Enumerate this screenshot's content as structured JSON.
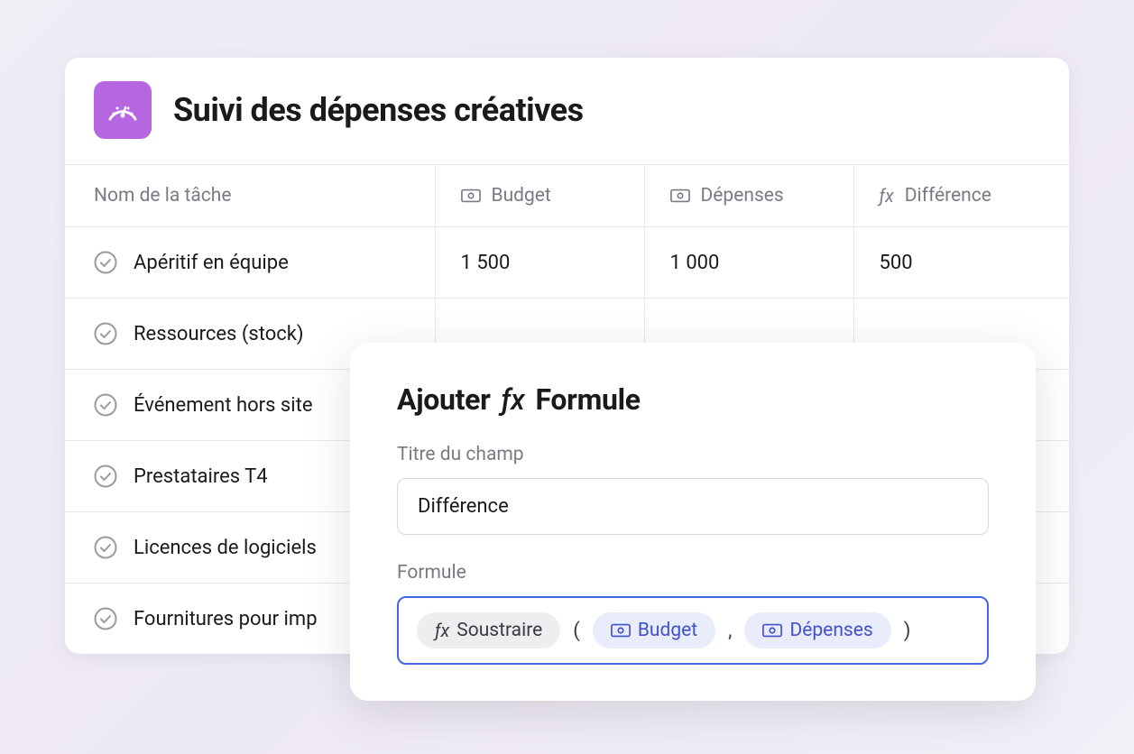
{
  "header": {
    "title": "Suivi des dépenses créatives"
  },
  "columns": {
    "task": "Nom de la tâche",
    "budget": "Budget",
    "expenses": "Dépenses",
    "difference": "Différence"
  },
  "rows": [
    {
      "task": "Apéritif en équipe",
      "budget": "1 500",
      "expenses": "1 000",
      "difference": "500"
    },
    {
      "task": "Ressources (stock)",
      "budget": "",
      "expenses": "",
      "difference": ""
    },
    {
      "task": "Événement hors site",
      "budget": "",
      "expenses": "",
      "difference": ""
    },
    {
      "task": "Prestataires T4",
      "budget": "",
      "expenses": "",
      "difference": ""
    },
    {
      "task": "Licences de logiciels",
      "budget": "",
      "expenses": "",
      "difference": ""
    },
    {
      "task": "Fournitures pour imp",
      "budget": "",
      "expenses": "",
      "difference": ""
    }
  ],
  "modal": {
    "title_prefix": "Ajouter",
    "title_suffix": "Formule",
    "field_title_label": "Titre du champ",
    "field_title_value": "Différence",
    "formula_label": "Formule",
    "formula": {
      "function": "Soustraire",
      "arg1": "Budget",
      "arg2": "Dépenses"
    }
  }
}
